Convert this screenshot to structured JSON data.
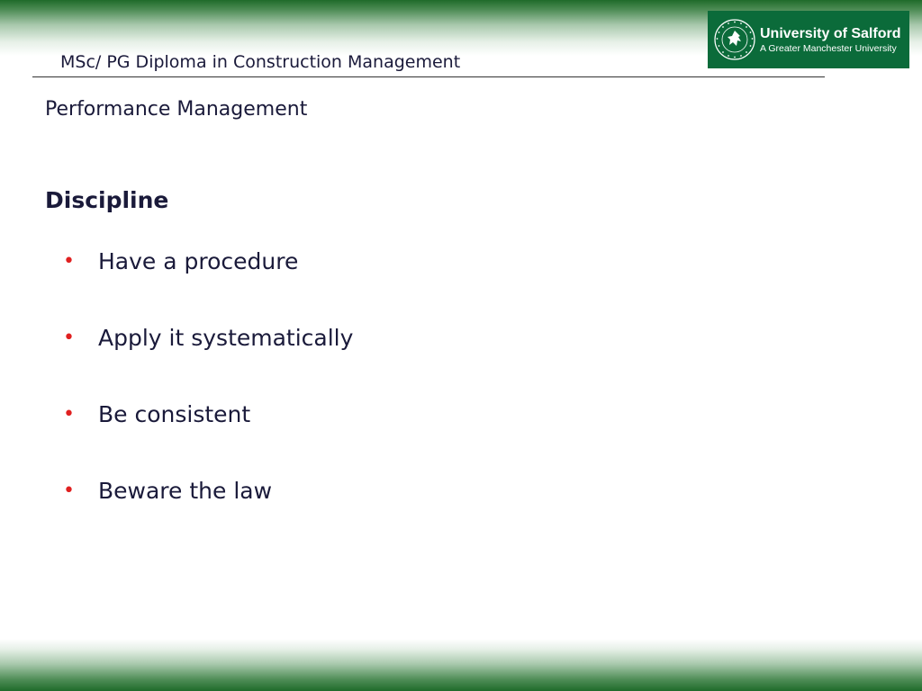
{
  "header": {
    "course_title": "MSc/ PG Diploma in Construction Management"
  },
  "logo": {
    "name": "University of Salford",
    "tagline": "A Greater Manchester University",
    "seal_text": "THE UNIVERSITY OF SALFORD",
    "seal_icon": "salford-crest-icon"
  },
  "slide": {
    "section_title": "Performance Management",
    "heading": "Discipline",
    "bullets": [
      "Have a procedure",
      "Apply it systematically",
      "Be consistent",
      "Beware the law"
    ]
  },
  "colors": {
    "band_green": "#1f6b2a",
    "logo_green": "#0b6b3a",
    "text": "#1a1a3a",
    "bullet_red": "#e02020"
  }
}
